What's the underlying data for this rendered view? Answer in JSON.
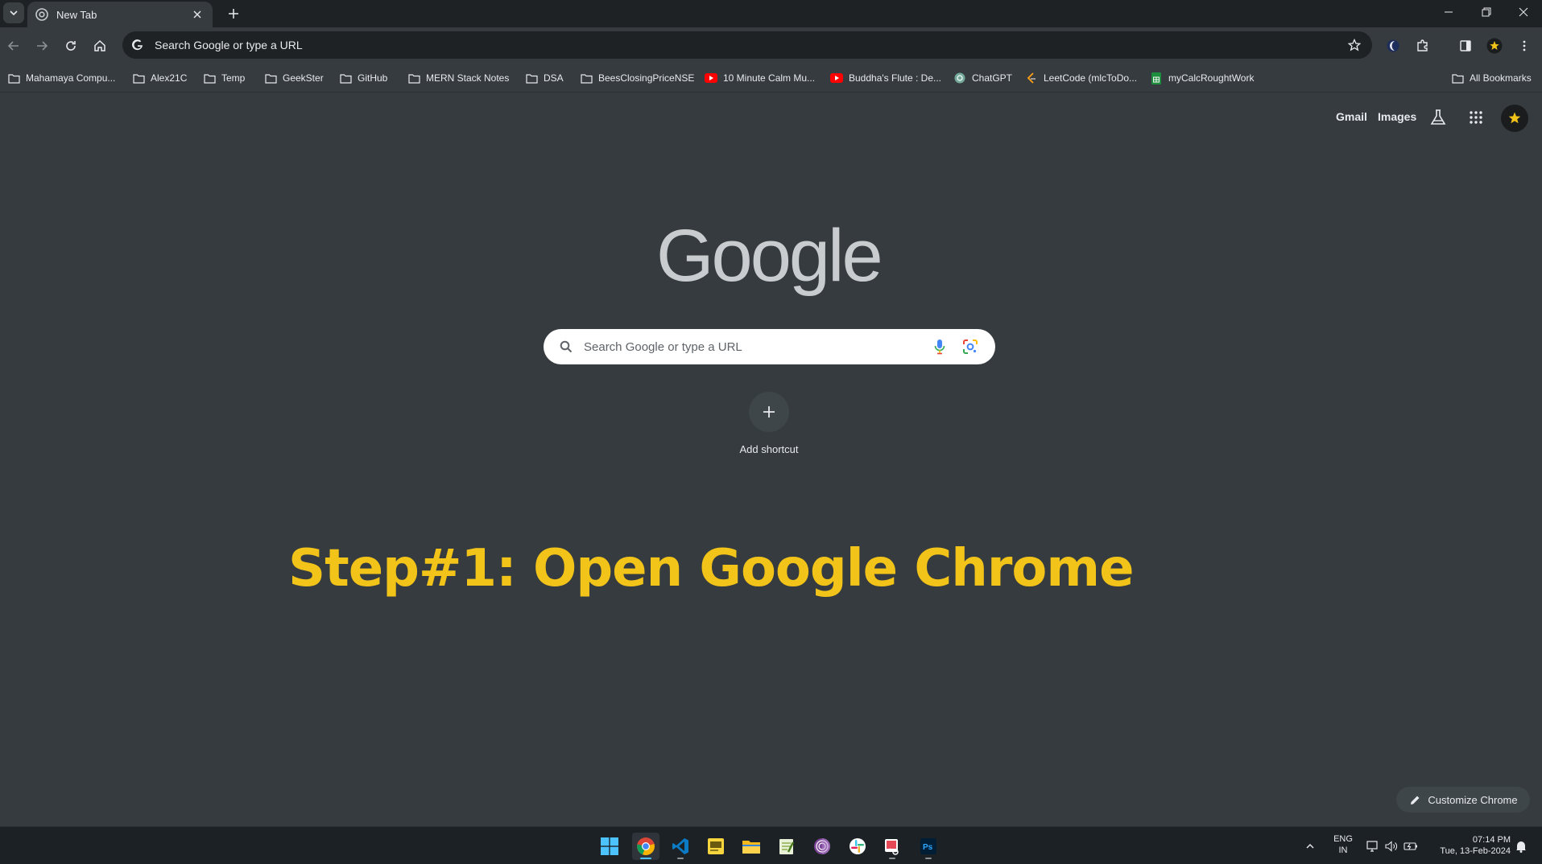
{
  "tab": {
    "title": "New Tab"
  },
  "omnibox": {
    "text": "Search Google or type a URL"
  },
  "bookmarks": {
    "items": [
      {
        "label": "Mahamaya Compu...",
        "icon": "folder-icon"
      },
      {
        "label": "Alex21C",
        "icon": "folder-icon"
      },
      {
        "label": "Temp",
        "icon": "folder-icon"
      },
      {
        "label": "GeekSter",
        "icon": "folder-icon"
      },
      {
        "label": "GitHub",
        "icon": "folder-icon"
      },
      {
        "label": "MERN Stack Notes",
        "icon": "folder-icon"
      },
      {
        "label": "DSA",
        "icon": "folder-icon"
      },
      {
        "label": "BeesClosingPriceNSE",
        "icon": "folder-icon"
      },
      {
        "label": "10 Minute Calm Mu...",
        "icon": "youtube-icon"
      },
      {
        "label": "Buddha's Flute : De...",
        "icon": "youtube-icon"
      },
      {
        "label": "ChatGPT",
        "icon": "chatgpt-icon"
      },
      {
        "label": "LeetCode (mlcToDo...",
        "icon": "leetcode-icon"
      },
      {
        "label": "myCalcRoughtWork",
        "icon": "sheets-icon"
      }
    ],
    "all_bookmarks": "All Bookmarks"
  },
  "ntp": {
    "gmail": "Gmail",
    "images": "Images",
    "logo": "Google",
    "search_placeholder": "Search Google or type a URL",
    "add_shortcut": "Add shortcut",
    "customize": "Customize Chrome"
  },
  "caption": "Step#1: Open Google Chrome",
  "taskbar": {
    "lang_top": "ENG",
    "lang_bottom": "IN",
    "time": "07:14 PM",
    "date": "Tue, 13-Feb-2024"
  },
  "colors": {
    "page_bg": "#353b3e",
    "caption": "#f2c318",
    "titlebar": "#1f2224",
    "taskbar": "#1c2126"
  }
}
